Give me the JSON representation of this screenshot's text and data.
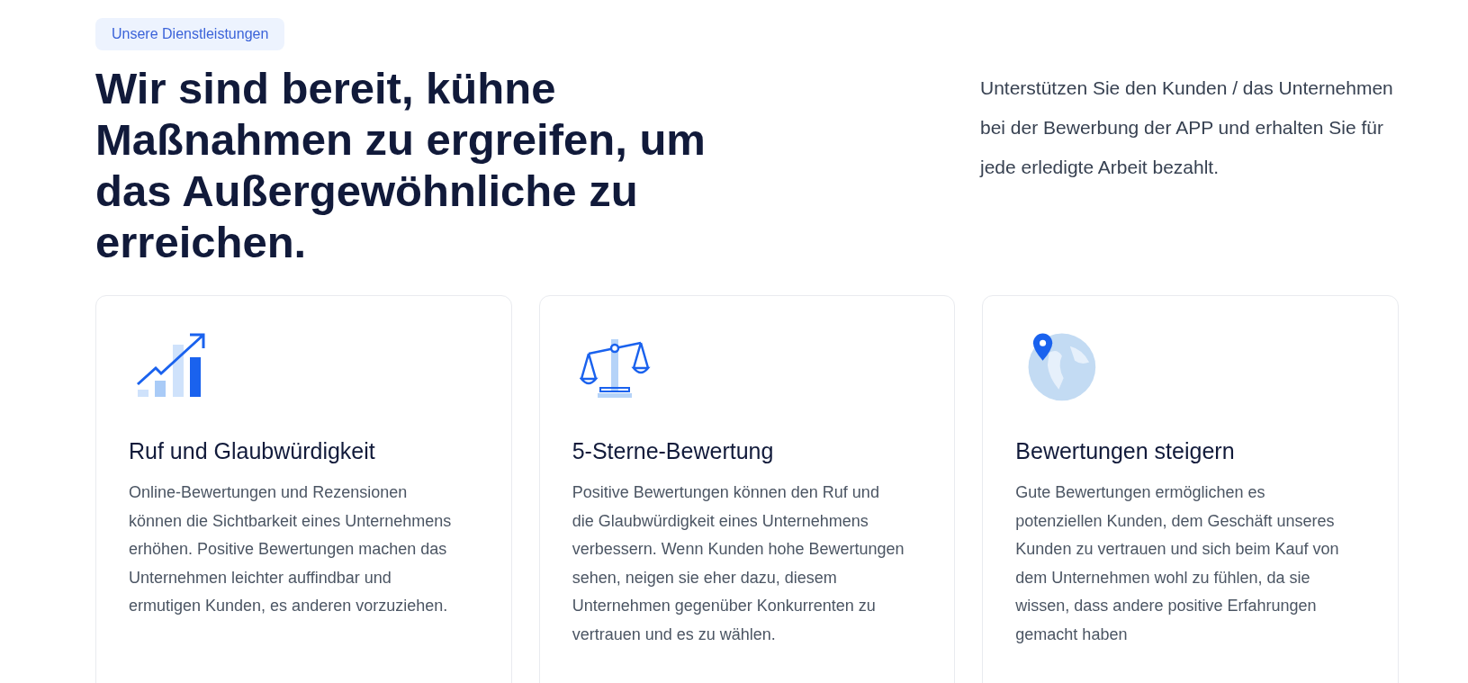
{
  "badge": "Unsere Dienstleistungen",
  "headline": "Wir sind bereit, kühne Maßnahmen zu ergreifen, um das Außergewöhnliche zu erreichen.",
  "intro": "Unterstützen Sie den Kunden / das Unternehmen bei der Bewerbung der APP und erhalten Sie für jede erledigte Arbeit bezahlt.",
  "cards": [
    {
      "kind": "chart",
      "title": "Ruf und Glaubwürdigkeit",
      "text": "Online-Bewertungen und Rezensionen können die Sichtbarkeit eines Unternehmens erhöhen. Positive Bewertungen machen das Unternehmen leichter auffindbar und ermutigen Kunden, es anderen vorzuziehen."
    },
    {
      "kind": "scale",
      "title": "5-Sterne-Bewertung",
      "text": "Positive Bewertungen können den Ruf und die Glaubwürdigkeit eines Unternehmens verbessern. Wenn Kunden hohe Bewertungen sehen, neigen sie eher dazu, diesem Unternehmen gegenüber Konkurrenten zu vertrauen und es zu wählen."
    },
    {
      "kind": "globe",
      "title": "Bewertungen steigern",
      "text": "Gute Bewertungen ermöglichen es potenziellen Kunden, dem Geschäft unseres Kunden zu vertrauen und sich beim Kauf von dem Unternehmen wohl zu fühlen, da sie wissen, dass andere positive Erfahrungen gemacht haben"
    }
  ]
}
